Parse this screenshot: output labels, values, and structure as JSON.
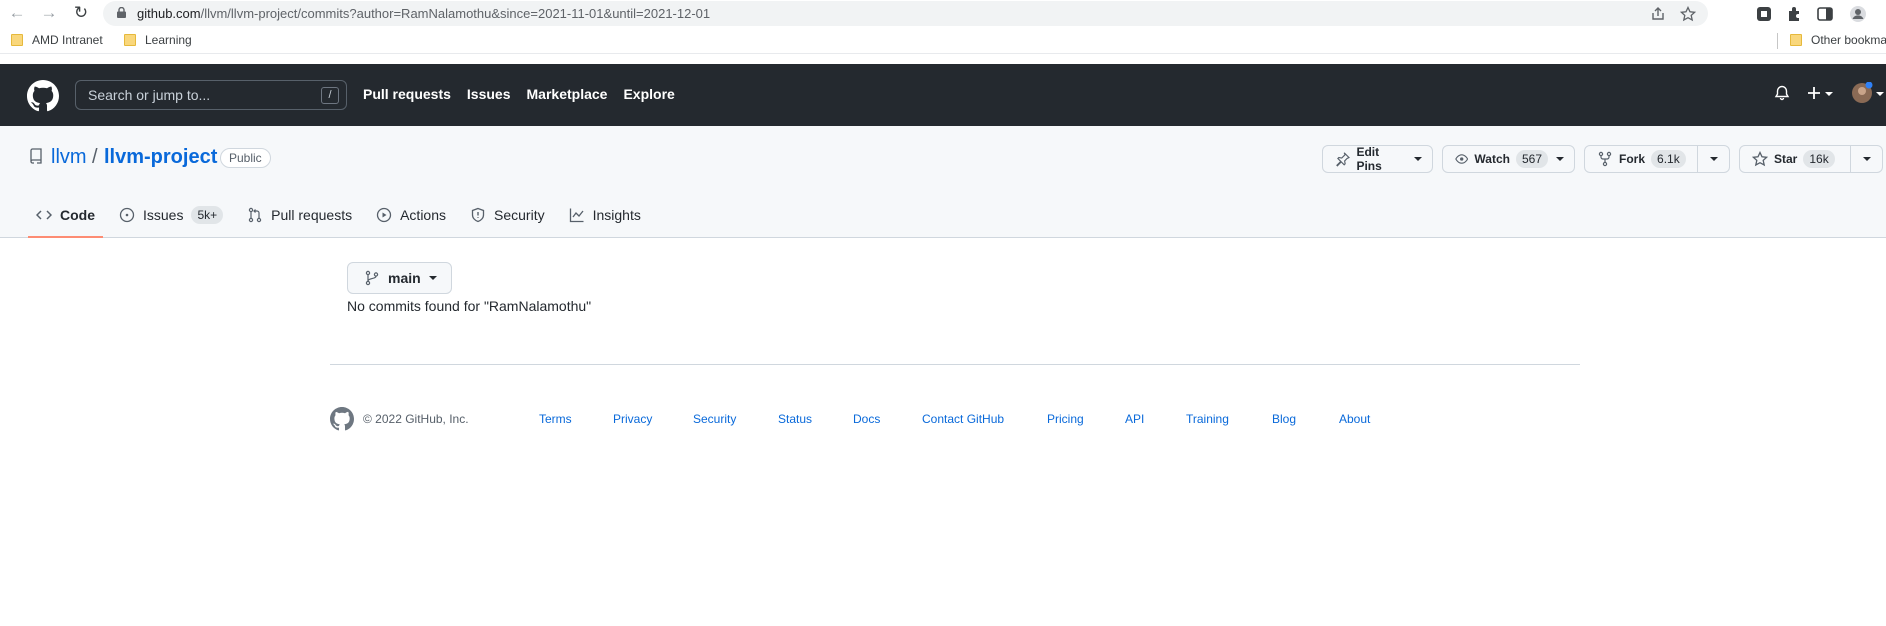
{
  "browser": {
    "url_host": "github.com",
    "url_path": "/llvm/llvm-project/commits?author=RamNalamothu&since=2021-11-01&until=2021-12-01",
    "bookmarks": [
      "AMD Intranet",
      "Learning"
    ],
    "other_bookmarks": "Other bookma"
  },
  "header": {
    "search_placeholder": "Search or jump to...",
    "slash_key": "/",
    "nav": [
      "Pull requests",
      "Issues",
      "Marketplace",
      "Explore"
    ]
  },
  "repo": {
    "owner": "llvm",
    "separator": "/",
    "name": "llvm-project",
    "visibility": "Public",
    "edit_pins": "Edit Pins",
    "watch": "Watch",
    "watch_count": "567",
    "fork": "Fork",
    "fork_count": "6.1k",
    "star": "Star",
    "star_count": "16k"
  },
  "tabs": [
    {
      "label": "Code",
      "icon": "code-icon"
    },
    {
      "label": "Issues",
      "icon": "issue-opened-icon",
      "count": "5k+"
    },
    {
      "label": "Pull requests",
      "icon": "git-pull-request-icon"
    },
    {
      "label": "Actions",
      "icon": "play-icon"
    },
    {
      "label": "Security",
      "icon": "shield-icon"
    },
    {
      "label": "Insights",
      "icon": "graph-icon"
    }
  ],
  "main": {
    "branch": "main",
    "message": "No commits found for \"RamNalamothu\""
  },
  "footer": {
    "copyright": "© 2022 GitHub, Inc.",
    "links": [
      "Terms",
      "Privacy",
      "Security",
      "Status",
      "Docs",
      "Contact GitHub",
      "Pricing",
      "API",
      "Training",
      "Blog",
      "About"
    ]
  },
  "colors": {
    "header_bg": "#24292f",
    "link": "#0969da",
    "tab_underline": "#fd8c73"
  }
}
